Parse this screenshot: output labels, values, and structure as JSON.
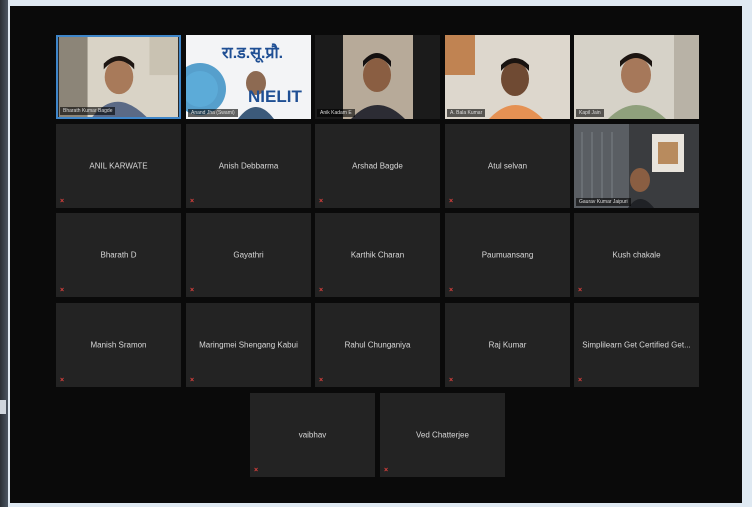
{
  "video_tiles": [
    {
      "caption": "Bharath Kumar Bagde",
      "bg": "#d9d3c6"
    },
    {
      "caption": "Anand Jha (Swami)",
      "logo_text": "रा.ड.सू.प्रौ.",
      "logo_sub": "NIELIT",
      "bg": "#f3f4f6"
    },
    {
      "caption": "Anik Kadam E",
      "bg": "#b7aa99"
    },
    {
      "caption": "A. Bala Kumar",
      "bg": "#ddd7cd"
    },
    {
      "caption": "Kapil Jain",
      "bg": "#d6d2c8"
    }
  ],
  "shared_tile": {
    "caption": "Gaurav Kumar Jaipuri",
    "bg": "#3a3c3f"
  },
  "name_tiles": [
    "ANIL KARWATE",
    "Anish Debbarma",
    "Arshad Bagde",
    "Atul selvan",
    "Bharath D",
    "Gayathri",
    "Karthik Charan",
    "Paumuansang",
    "Kush chakale",
    "Manish Sramon",
    "Maringmei Shengang Kabui",
    "Rahul Chunganiya",
    "Raj Kumar",
    "Simplilearn Get Certified Get...",
    "vaibhav",
    "Ved Chatterjee"
  ],
  "mic_glyph": "×",
  "colors": {
    "active_border": "#3f86c9",
    "tile_bg": "#232323",
    "muted_icon": "#e0413e",
    "window_bg": "#0a0a0a"
  }
}
